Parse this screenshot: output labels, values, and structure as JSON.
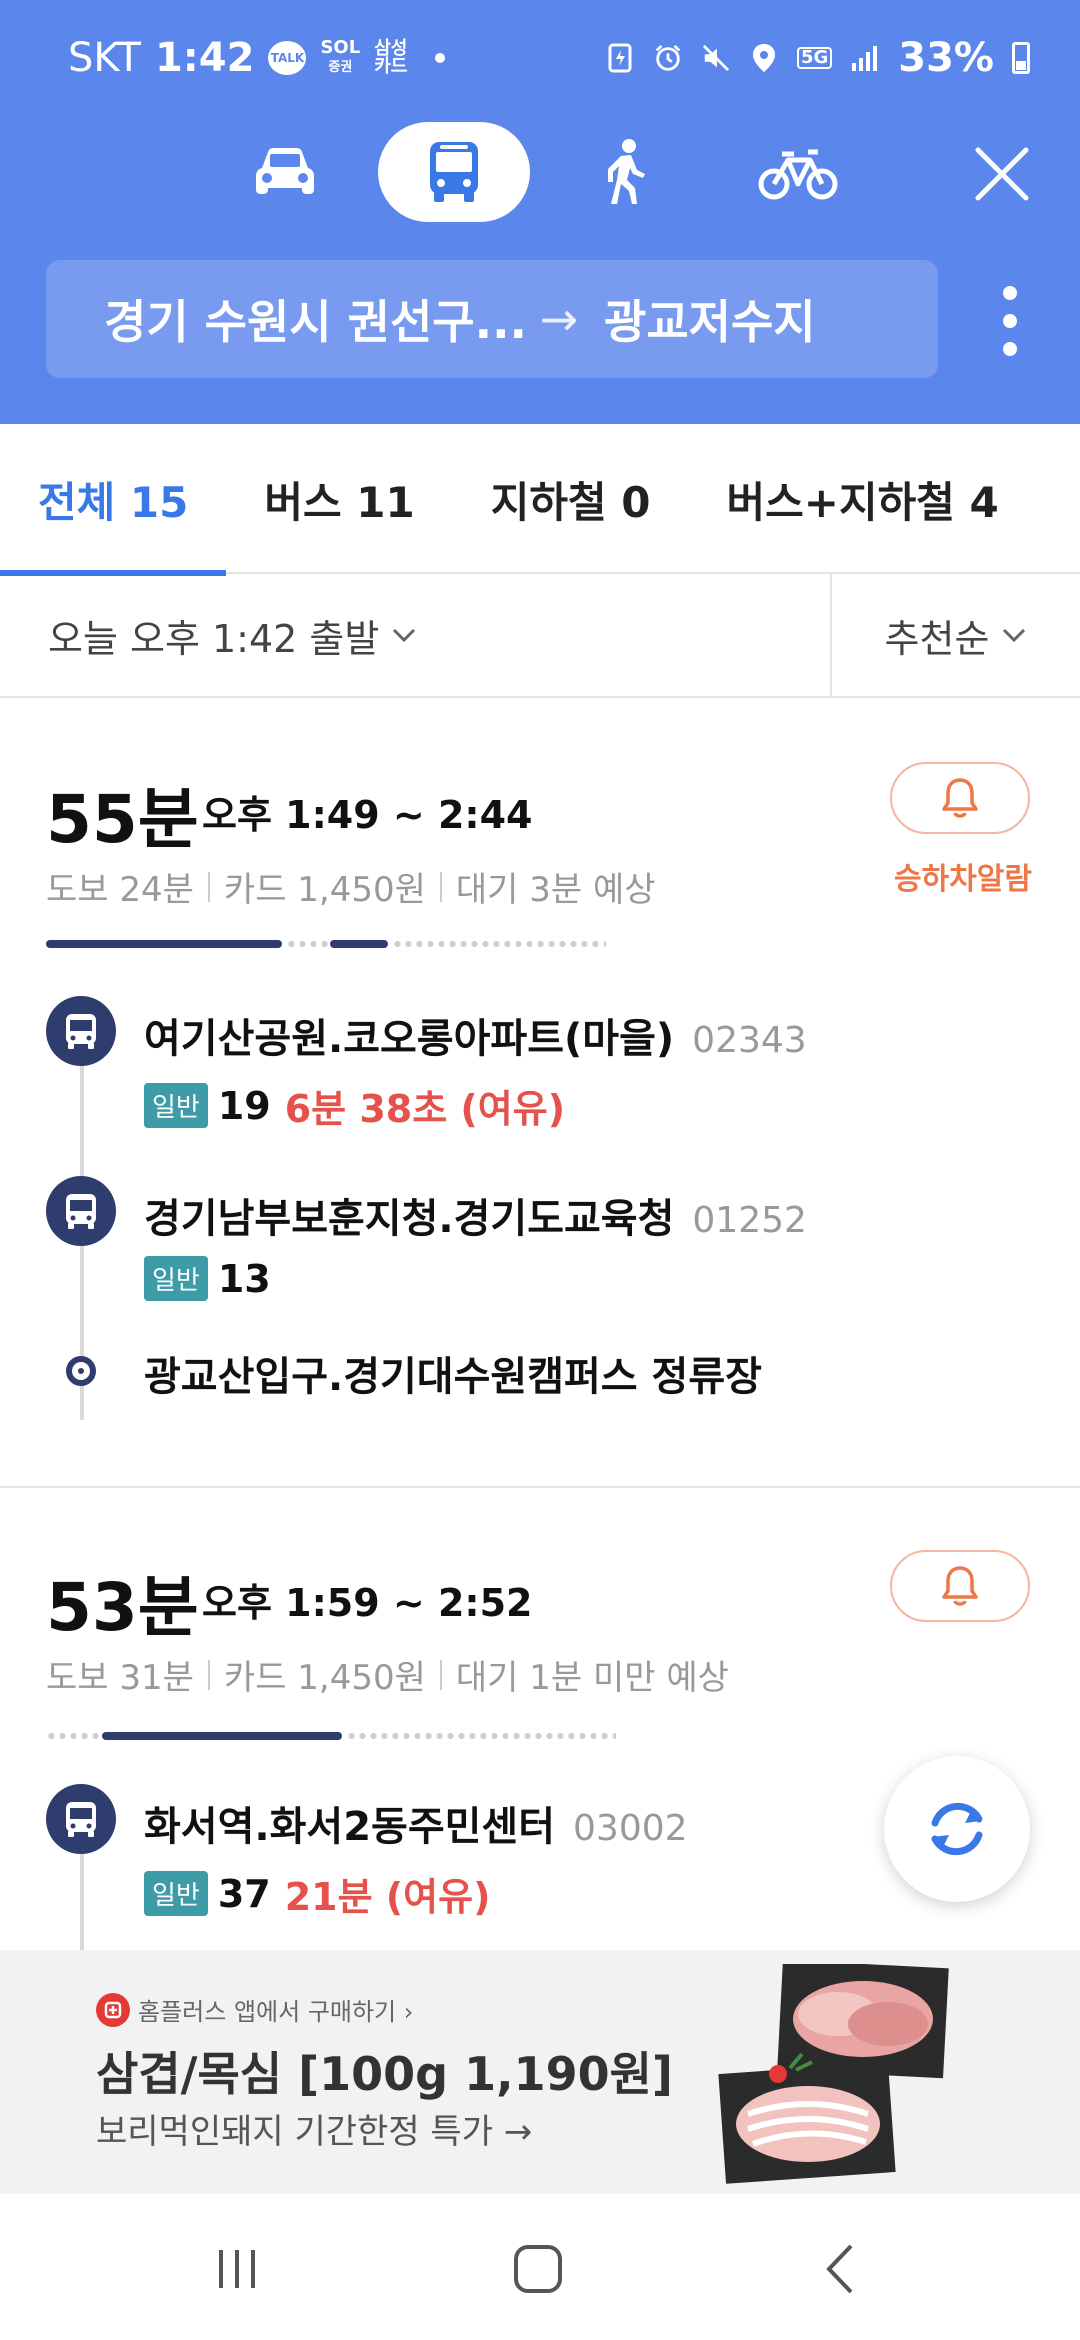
{
  "status_bar": {
    "carrier": "SKT",
    "time": "1:42",
    "talk_label": "TALK",
    "app1_label_top": "SOL",
    "app1_label_bottom": "증권",
    "app2_label_top": "삼성",
    "app2_label_bottom": "카드",
    "network": "5G",
    "battery": "33%"
  },
  "modes": [
    {
      "name": "car",
      "icon": "car-icon",
      "active": false
    },
    {
      "name": "bus",
      "icon": "bus-icon",
      "active": true
    },
    {
      "name": "walk",
      "icon": "walk-icon",
      "active": false
    },
    {
      "name": "bike",
      "icon": "bike-icon",
      "active": false
    }
  ],
  "route": {
    "from": "경기 수원시 권선구...",
    "arrow": "→",
    "to": "광교저수지"
  },
  "tabs": [
    {
      "label": "전체 15",
      "active": true
    },
    {
      "label": "버스 11",
      "active": false
    },
    {
      "label": "지하철 0",
      "active": false
    },
    {
      "label": "버스+지하철 4",
      "active": false
    }
  ],
  "filters": {
    "departure": "오늘 오후 1:42 출발",
    "sort": "추천순"
  },
  "routes": [
    {
      "duration": "55분",
      "time_range": "오후 1:49 ~ 2:44",
      "walk": "도보 24분",
      "fare": "카드 1,450원",
      "wait": "대기 3분 예상",
      "alarm_label": "승하차알람",
      "stops": [
        {
          "name": "여기산공원.코오롱아파트(마을)",
          "id": "02343",
          "badge": "일반",
          "bus": "19",
          "arrival": "6분 38초 (여유)"
        },
        {
          "name": "경기남부보훈지청.경기도교육청",
          "id": "01252",
          "badge": "일반",
          "bus": "13",
          "arrival": ""
        }
      ],
      "destination": "광교산입구.경기대수원캠퍼스 정류장"
    },
    {
      "duration": "53분",
      "time_range": "오후 1:59 ~ 2:52",
      "walk": "도보 31분",
      "fare": "카드 1,450원",
      "wait": "대기 1분 미만 예상",
      "stops": [
        {
          "name": "화서역.화서2동주민센터",
          "id": "03002",
          "badge": "일반",
          "bus": "37",
          "arrival": "21분 (여유)"
        }
      ]
    }
  ],
  "ad": {
    "source": "홈플러스 앱에서 구매하기 ›",
    "title": "삼겹/목심 [100g 1,190원]",
    "subtitle": "보리먹인돼지 기간한정 특가 →"
  },
  "colors": {
    "header_bg": "#5B86EC",
    "accent": "#3B78E7",
    "route_line": "#2F3C6E",
    "arrival_red": "#E5514B",
    "alarm_orange": "#EE7748",
    "badge_teal": "#3E9BA8"
  }
}
